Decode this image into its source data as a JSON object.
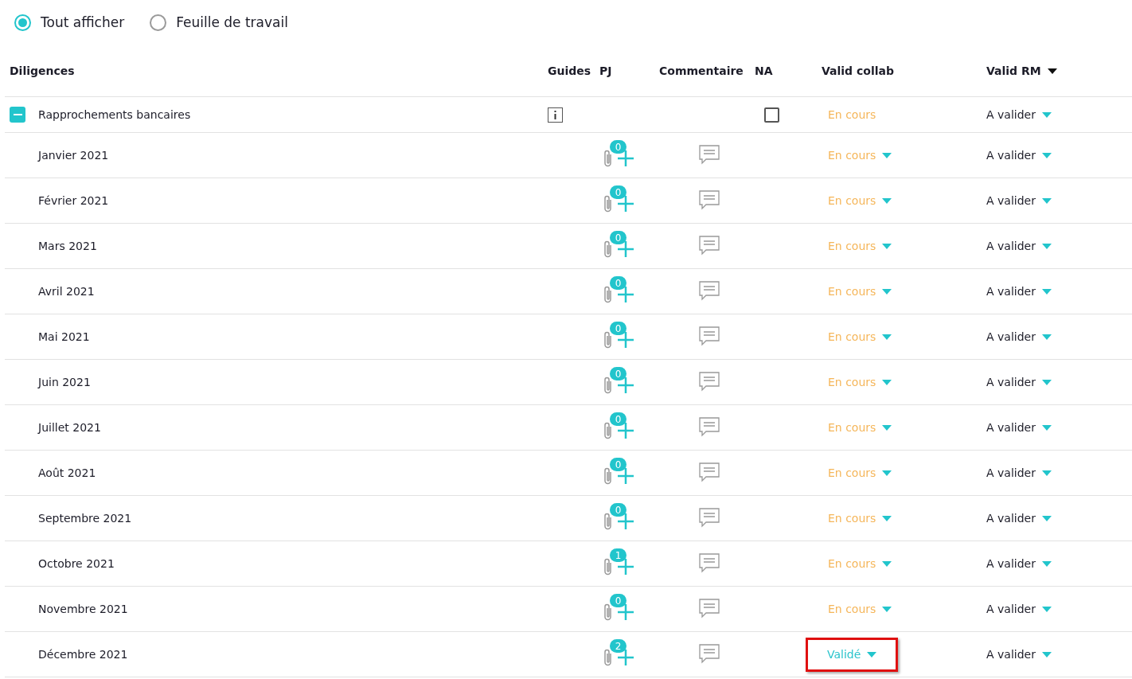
{
  "view_options": [
    {
      "label": "Tout afficher",
      "selected": true
    },
    {
      "label": "Feuille de travail",
      "selected": false
    }
  ],
  "table": {
    "columns": [
      {
        "label": "Diligences",
        "sorted": false
      },
      {
        "label": "Guides",
        "sorted": false
      },
      {
        "label": "PJ",
        "sorted": false
      },
      {
        "label": "Commentaire",
        "sorted": false
      },
      {
        "label": "NA",
        "sorted": false
      },
      {
        "label": "Valid collab",
        "sorted": false
      },
      {
        "label": "Valid RM",
        "sorted": true
      }
    ],
    "group": {
      "name": "Rapprochements bancaires",
      "expanded": true,
      "na_checked": false,
      "collab": {
        "label": "En cours",
        "kind": "pending",
        "dropdown": false,
        "highlighted": false
      },
      "rm": {
        "label": "A valider",
        "dropdown": true
      }
    },
    "rows": [
      {
        "name": "Janvier 2021",
        "attachments": "0",
        "collab": {
          "label": "En cours",
          "kind": "pending",
          "dropdown": true,
          "highlighted": false
        },
        "rm": {
          "label": "A valider",
          "dropdown": true
        }
      },
      {
        "name": "Février 2021",
        "attachments": "0",
        "collab": {
          "label": "En cours",
          "kind": "pending",
          "dropdown": true,
          "highlighted": false
        },
        "rm": {
          "label": "A valider",
          "dropdown": true
        }
      },
      {
        "name": "Mars 2021",
        "attachments": "0",
        "collab": {
          "label": "En cours",
          "kind": "pending",
          "dropdown": true,
          "highlighted": false
        },
        "rm": {
          "label": "A valider",
          "dropdown": true
        }
      },
      {
        "name": "Avril 2021",
        "attachments": "0",
        "collab": {
          "label": "En cours",
          "kind": "pending",
          "dropdown": true,
          "highlighted": false
        },
        "rm": {
          "label": "A valider",
          "dropdown": true
        }
      },
      {
        "name": "Mai 2021",
        "attachments": "0",
        "collab": {
          "label": "En cours",
          "kind": "pending",
          "dropdown": true,
          "highlighted": false
        },
        "rm": {
          "label": "A valider",
          "dropdown": true
        }
      },
      {
        "name": "Juin 2021",
        "attachments": "0",
        "collab": {
          "label": "En cours",
          "kind": "pending",
          "dropdown": true,
          "highlighted": false
        },
        "rm": {
          "label": "A valider",
          "dropdown": true
        }
      },
      {
        "name": "Juillet 2021",
        "attachments": "0",
        "collab": {
          "label": "En cours",
          "kind": "pending",
          "dropdown": true,
          "highlighted": false
        },
        "rm": {
          "label": "A valider",
          "dropdown": true
        }
      },
      {
        "name": "Août 2021",
        "attachments": "0",
        "collab": {
          "label": "En cours",
          "kind": "pending",
          "dropdown": true,
          "highlighted": false
        },
        "rm": {
          "label": "A valider",
          "dropdown": true
        }
      },
      {
        "name": "Septembre 2021",
        "attachments": "0",
        "collab": {
          "label": "En cours",
          "kind": "pending",
          "dropdown": true,
          "highlighted": false
        },
        "rm": {
          "label": "A valider",
          "dropdown": true
        }
      },
      {
        "name": "Octobre 2021",
        "attachments": "1",
        "collab": {
          "label": "En cours",
          "kind": "pending",
          "dropdown": true,
          "highlighted": false
        },
        "rm": {
          "label": "A valider",
          "dropdown": true
        }
      },
      {
        "name": "Novembre 2021",
        "attachments": "0",
        "collab": {
          "label": "En cours",
          "kind": "pending",
          "dropdown": true,
          "highlighted": false
        },
        "rm": {
          "label": "A valider",
          "dropdown": true
        }
      },
      {
        "name": "Décembre 2021",
        "attachments": "2",
        "collab": {
          "label": "Validé",
          "kind": "validated",
          "dropdown": true,
          "highlighted": true
        },
        "rm": {
          "label": "A valider",
          "dropdown": true
        }
      }
    ]
  }
}
